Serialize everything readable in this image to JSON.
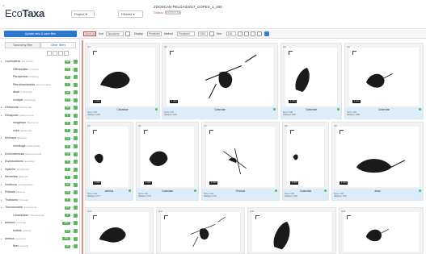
{
  "header": {
    "logo_part1": "Eco",
    "logo_part2": "Taxa",
    "project_menu": "Project",
    "filtered_menu": "Filtered",
    "project_title": "ZOOSCAN PELGAS2017_COPES_1_200",
    "project_owner": "John Doe",
    "project_status_label": "Status:",
    "project_status_value": "Annotate"
  },
  "toolbar": {
    "filter_button": "Update view & save filter",
    "select_all": "Select all",
    "sort_label": "Sort",
    "sort_value": "Taxonomy",
    "display_label": "Display",
    "display_value": "Predicted",
    "method_label": "Method",
    "method_value": "Predicted",
    "page_size": "1000",
    "zoom_label": "Dim.",
    "zoom_value": "100"
  },
  "sidebar": {
    "tab_taxonomy": "Taxonomy filter",
    "tab_other": "Other filters",
    "items": [
      {
        "label": "Lepidoptera",
        "sci": "(Hexapoda)",
        "count": "34"
      },
      {
        "label": "Diffusicidae",
        "sci": "(Cnidaria)",
        "count": "12"
      },
      {
        "label": "Parapertusi",
        "sci": "(Cnidaria)",
        "count": "8"
      },
      {
        "label": "Pterobrachiosida",
        "sci": "(Hemichordata)",
        "count": "5"
      },
      {
        "label": "dead",
        "sci": "(Copepoda)",
        "count": "41"
      },
      {
        "label": "multiple",
        "sci": "(Copepoda)",
        "count": "17"
      },
      {
        "label": "Ostracoda",
        "sci": "(Arthropoda)",
        "count": "22"
      },
      {
        "label": "Decapoda",
        "sci": "(Malacostraca)",
        "count": "9"
      },
      {
        "label": "megalopa",
        "sci": "(Brachyura)",
        "count": "3"
      },
      {
        "label": "zoea",
        "sci": "(Decapoda)",
        "count": "6"
      },
      {
        "label": "Mollusca",
        "sci": "(Bilateria)",
        "count": "14"
      },
      {
        "label": "shrinkage",
        "sci": "(Gastropoda)",
        "count": "2"
      },
      {
        "label": "Echinodermata",
        "sci": "(Deuterostomia)",
        "count": "11"
      },
      {
        "label": "Euphausiacea",
        "sci": "(Eucarida)",
        "count": "7"
      },
      {
        "label": "Hyalella",
        "sci": "(Amphipoda)",
        "count": "4"
      },
      {
        "label": "Nemertea",
        "sci": "(Bilateria)",
        "count": "3"
      },
      {
        "label": "Noctiluca",
        "sci": "(Dinoflagellata)",
        "count": "18"
      },
      {
        "label": "Rhizaria",
        "sci": "(Harosa)",
        "count": "25"
      },
      {
        "label": "Thaliacea",
        "sci": "(Tunicata)",
        "count": "6"
      },
      {
        "label": "Thecosomata",
        "sci": "(Gastropoda)",
        "count": "15"
      },
      {
        "label": "Limacinidae",
        "sci": "(Thecosomata)",
        "count": "4"
      },
      {
        "label": "artefact",
        "sci": "(not-living)",
        "count": "210"
      },
      {
        "label": "bubble",
        "sci": "(artefact)",
        "count": "13"
      },
      {
        "label": "detritus",
        "sci": "(not-living)",
        "count": "480"
      },
      {
        "label": "fiber",
        "sci": "(detritus)",
        "count": "37"
      }
    ]
  },
  "vignettes": [
    {
      "num": "(1)",
      "taxon": "Calanidae",
      "scale": "1 mm",
      "meta1": "Score: 0.98",
      "meta2": "Validated: 1290"
    },
    {
      "num": "(2)",
      "taxon": "Calanidae",
      "scale": "1 mm",
      "meta1": "Score: 0.98",
      "meta2": "Validated: 1292"
    },
    {
      "num": "(3)",
      "taxon": "Calanidae",
      "scale": "1 mm",
      "meta1": "Score: 0.98",
      "meta2": "Validated: 1295"
    },
    {
      "num": "(4)",
      "taxon": "Calanidae",
      "scale": "1 mm",
      "meta1": "Score: 0.98",
      "meta2": "Validated: 1298"
    },
    {
      "num": "(5)",
      "taxon": "detritus",
      "scale": "1 mm",
      "meta1": "Score: 0.98",
      "meta2": "Validated: 1777"
    },
    {
      "num": "(6)",
      "taxon": "Calanidae",
      "scale": "1 mm",
      "meta1": "Score: 0.98",
      "meta2": "Validated: 1778"
    },
    {
      "num": "(7)",
      "taxon": "Rhizaria",
      "scale": "1 mm",
      "meta1": "Score: 0.98",
      "meta2": "Validated: 1779"
    },
    {
      "num": "(8)",
      "taxon": "Calanidae",
      "scale": "1 mm",
      "meta1": "Score: 0.98",
      "meta2": "Validated: 1780"
    },
    {
      "num": "(9)",
      "taxon": "dead",
      "scale": "1 mm",
      "meta1": "Score: 0.98",
      "meta2": "Validated: 1781"
    },
    {
      "num": "(10)",
      "taxon": "",
      "scale": "",
      "meta1": "",
      "meta2": ""
    },
    {
      "num": "(11)",
      "taxon": "",
      "scale": "",
      "meta1": "",
      "meta2": ""
    },
    {
      "num": "(12)",
      "taxon": "",
      "scale": "",
      "meta1": "",
      "meta2": ""
    },
    {
      "num": "(13)",
      "taxon": "",
      "scale": "",
      "meta1": "",
      "meta2": ""
    }
  ],
  "colors": {
    "accent": "#2e76c9",
    "count_badge": "#5cb85c",
    "caption_bg": "#dcecf8",
    "selection_line": "#e88c8c"
  }
}
